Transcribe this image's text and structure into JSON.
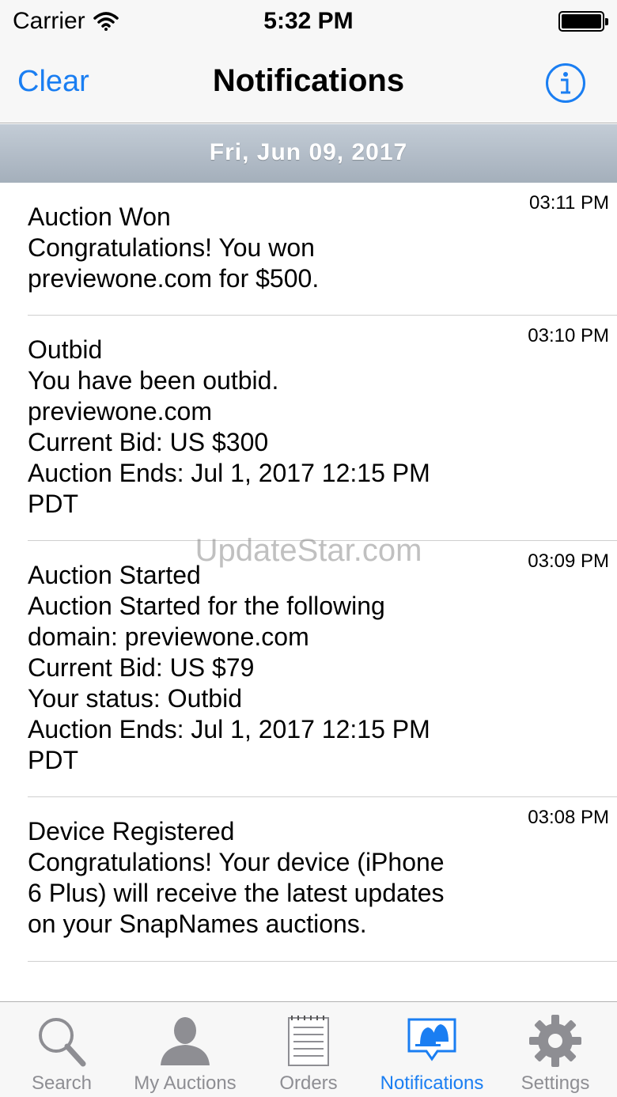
{
  "status_bar": {
    "carrier": "Carrier",
    "time": "5:32 PM",
    "icons": [
      "wifi-icon",
      "battery-icon"
    ]
  },
  "nav": {
    "left_button": "Clear",
    "title": "Notifications",
    "right_icon": "info-icon"
  },
  "date_header": "Fri, Jun 09, 2017",
  "notifications": [
    {
      "time": "03:11 PM",
      "title": "Auction Won",
      "lines": [
        "Congratulations!  You won",
        "previewone.com for $500."
      ]
    },
    {
      "time": "03:10 PM",
      "title": "Outbid",
      "lines": [
        "You have been outbid.",
        "previewone.com",
        "Current Bid: US $300",
        "Auction Ends: Jul 1, 2017 12:15 PM",
        "PDT"
      ]
    },
    {
      "time": "03:09 PM",
      "title": "Auction Started",
      "lines": [
        "Auction Started for the following",
        "domain: previewone.com",
        "Current Bid: US $79",
        "Your status: Outbid",
        "Auction Ends: Jul 1, 2017 12:15 PM",
        "PDT"
      ]
    },
    {
      "time": "03:08 PM",
      "title": "Device Registered",
      "lines": [
        "Congratulations! Your device (iPhone",
        "6 Plus) will receive the latest updates",
        "on your SnapNames auctions."
      ]
    }
  ],
  "watermark": "UpdateStar.com",
  "tabs": [
    {
      "label": "Search",
      "icon": "magnifier-icon"
    },
    {
      "label": "My Auctions",
      "icon": "person-icon"
    },
    {
      "label": "Orders",
      "icon": "notepad-icon"
    },
    {
      "label": "Notifications",
      "icon": "notifications-bell-icon",
      "active": true
    },
    {
      "label": "Settings",
      "icon": "gear-icon"
    }
  ],
  "colors": {
    "accent": "#1a7ef2",
    "tab_inactive": "#8e8e93",
    "section_header": "#b4bec9"
  }
}
